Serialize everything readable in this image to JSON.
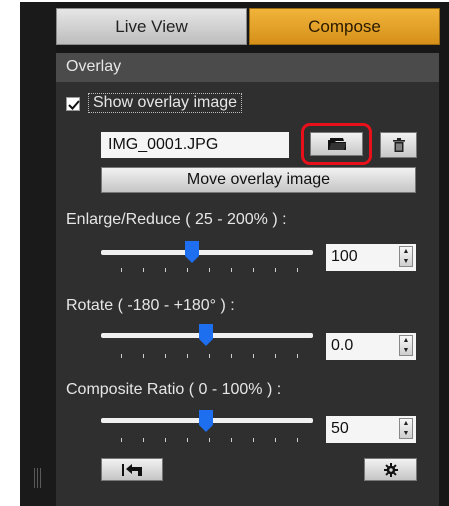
{
  "tabs": [
    {
      "label": "Live View",
      "active": false
    },
    {
      "label": "Compose",
      "active": true
    }
  ],
  "overlay": {
    "title": "Overlay",
    "show_overlay": {
      "label": "Show overlay image",
      "checked": true
    },
    "file_name": "IMG_0001.JPG",
    "open_icon": "folder-icon",
    "delete_icon": "trash-icon",
    "highlight_color": "#e8101a",
    "move_label": "Move overlay image"
  },
  "enlarge": {
    "label": "Enlarge/Reduce ( 25 - 200% ) :",
    "value": "100",
    "slider_fraction": 0.43
  },
  "rotate": {
    "label": "Rotate ( -180 - +180° ) :",
    "value": "0.0",
    "slider_fraction": 0.5
  },
  "ratio": {
    "label": "Composite Ratio ( 0 - 100% ) :",
    "value": "50",
    "slider_fraction": 0.5
  },
  "footer": {
    "reset_icon": "undo-arrow-icon",
    "settings_icon": "gear-icon"
  },
  "colors": {
    "active_tab": "#e6a22a",
    "panel": "#2f2f2f",
    "slider_thumb": "#1d6ff0"
  }
}
